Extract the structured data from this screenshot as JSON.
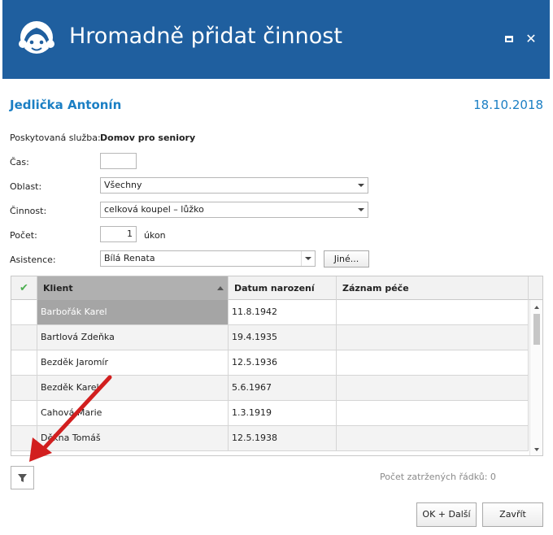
{
  "window": {
    "title": "Hromadně přidat činnost",
    "maximize_icon": "maximize-icon",
    "close_icon": "close-icon",
    "close_glyph": "✕",
    "brand_color": "#1f5f9f"
  },
  "header": {
    "client_name": "Jedlička Antonín",
    "date": "18.10.2018",
    "accent_color": "#1b7fc4"
  },
  "form": {
    "service_label": "Poskytovaná služba:",
    "service_value": "Domov pro seniory",
    "time_label": "Čas:",
    "time_value": "",
    "area_label": "Oblast:",
    "area_value": "Všechny",
    "activity_label": "Činnost:",
    "activity_value": "celková koupel – lůžko",
    "count_label": "Počet:",
    "count_value": "1",
    "count_unit": "úkon",
    "assist_label": "Asistence:",
    "assist_value": "Bílá Renata",
    "other_button": "Jiné..."
  },
  "grid": {
    "check_glyph": "✔",
    "columns": [
      "Klient",
      "Datum narození",
      "Záznam péče"
    ],
    "rows": [
      {
        "client": "Barbořák Karel",
        "dob": "11.8.1942",
        "record": ""
      },
      {
        "client": "Bartlová Zdeňka",
        "dob": "19.4.1935",
        "record": ""
      },
      {
        "client": "Bezděk Jaromír",
        "dob": "12.5.1936",
        "record": ""
      },
      {
        "client": "Bezděk Karel",
        "dob": "5.6.1967",
        "record": ""
      },
      {
        "client": "Cahová Marie",
        "dob": "1.3.1919",
        "record": ""
      },
      {
        "client": "Děkna Tomáš",
        "dob": "12.5.1938",
        "record": ""
      }
    ]
  },
  "footer": {
    "filter_icon": "filter-icon",
    "row_count": "Počet zatržených řádků: 0",
    "ok_button": "OK + Další",
    "close_button": "Zavřít"
  }
}
